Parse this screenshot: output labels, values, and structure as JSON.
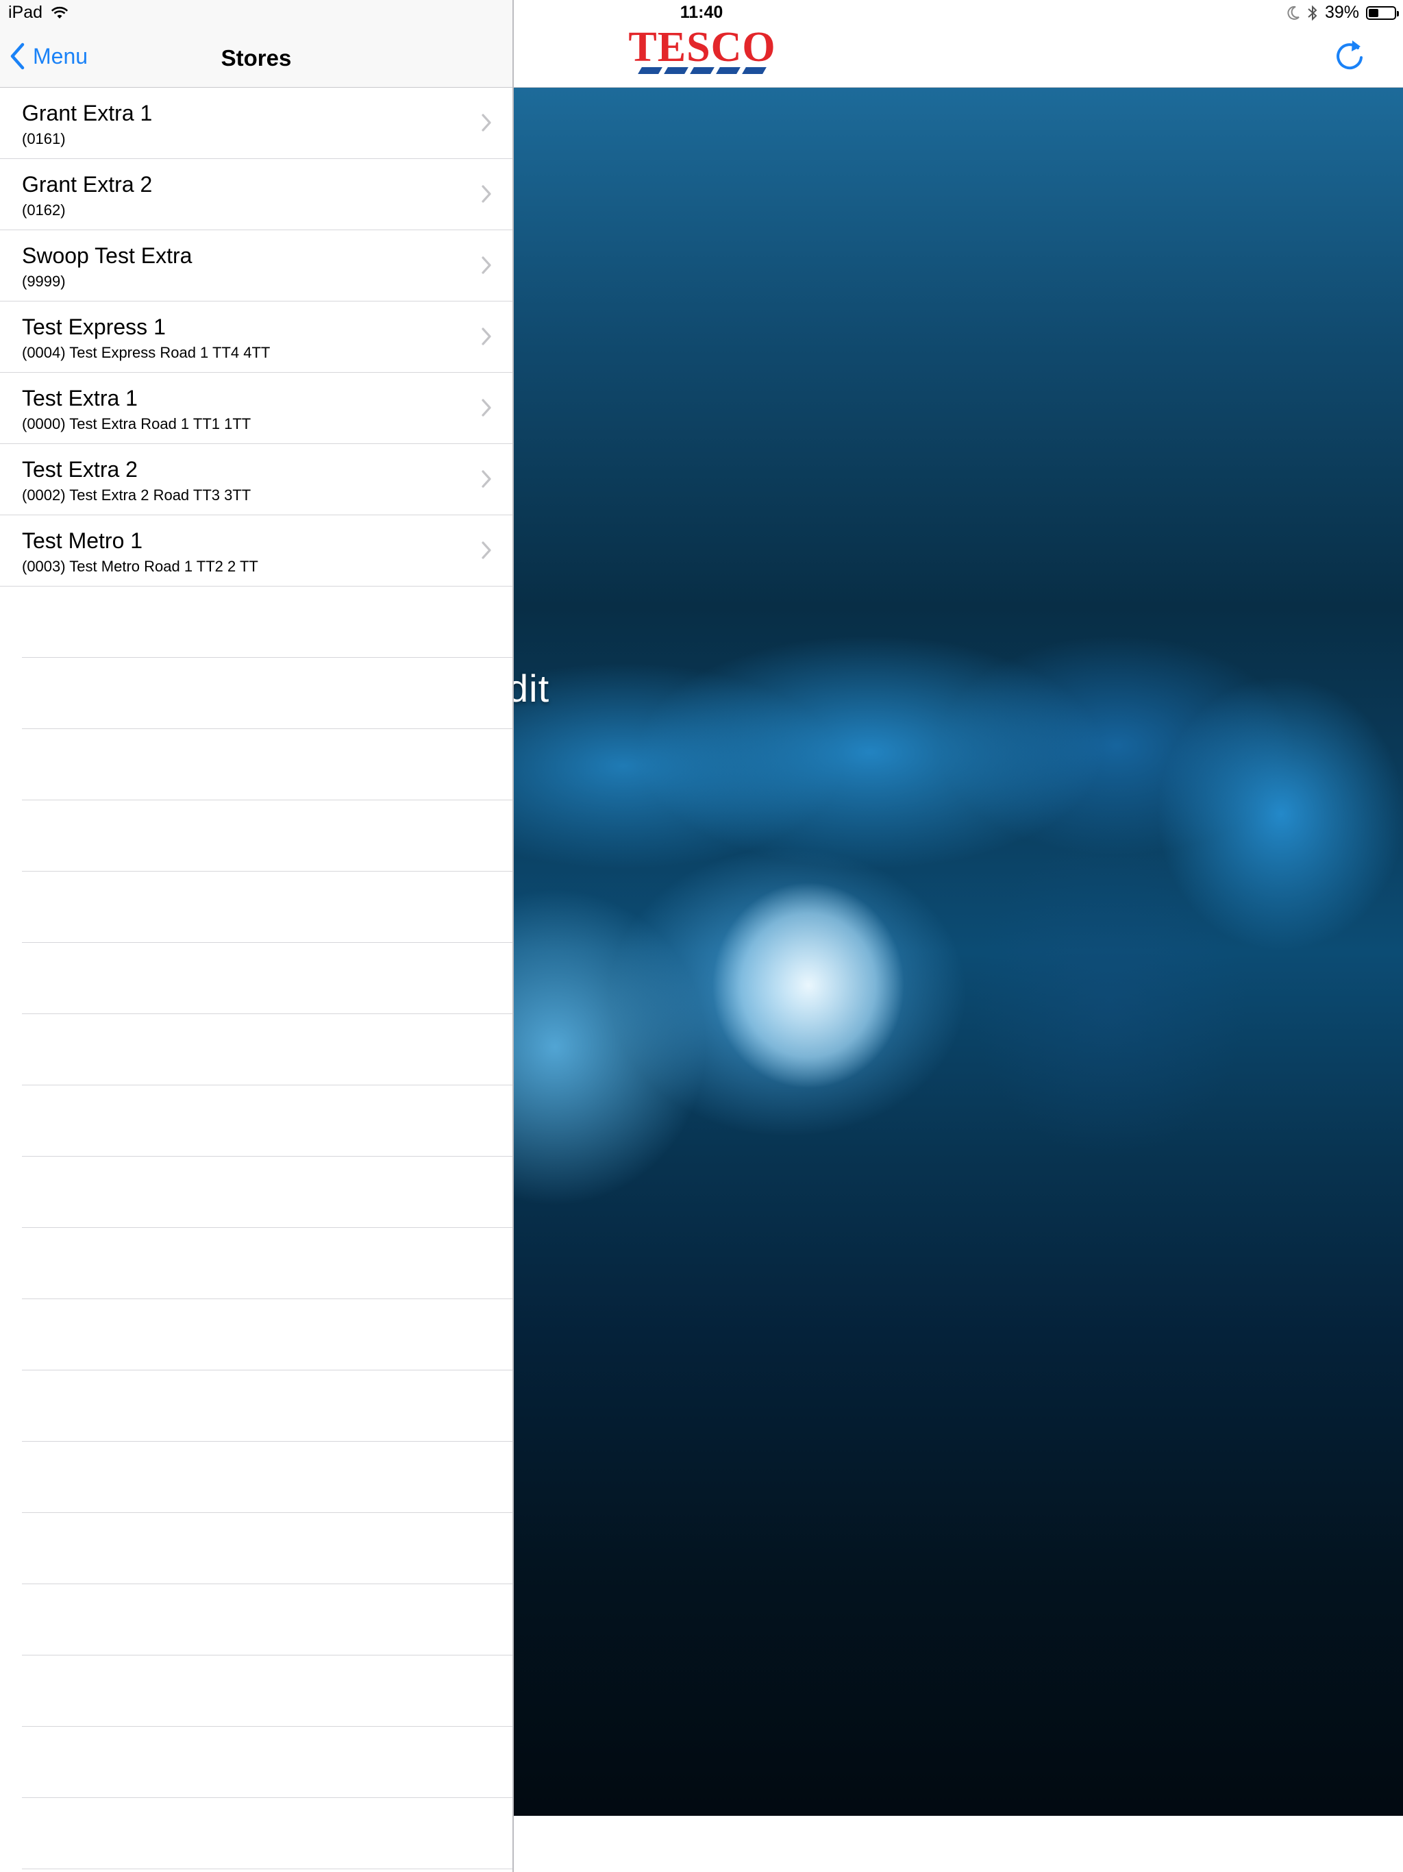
{
  "status_bar": {
    "device": "iPad",
    "time": "11:40",
    "battery_percent": "39%",
    "battery_level": 0.39,
    "icons": [
      "wifi-icon",
      "moon-icon",
      "bluetooth-icon",
      "battery-icon"
    ]
  },
  "master": {
    "back_label": "Menu",
    "title": "Stores",
    "stores": [
      {
        "name": "Grant Extra 1",
        "detail": "(0161)"
      },
      {
        "name": "Grant Extra 2",
        "detail": "(0162)"
      },
      {
        "name": "Swoop Test Extra",
        "detail": "(9999)"
      },
      {
        "name": "Test Express 1",
        "detail": "(0004) Test Express Road 1 TT4 4TT"
      },
      {
        "name": "Test Extra 1",
        "detail": "(0000) Test Extra Road 1 TT1 1TT"
      },
      {
        "name": "Test Extra 2",
        "detail": "(0002) Test Extra 2 Road TT3 3TT"
      },
      {
        "name": "Test Metro 1",
        "detail": "(0003) Test Metro Road 1 TT2 2 TT"
      }
    ]
  },
  "detail": {
    "logo_text": "TESCO",
    "hero_text": "dit",
    "refresh_icon": "refresh-icon"
  },
  "colors": {
    "accent": "#1a82f7",
    "tesco_red": "#e3262a",
    "tesco_blue": "#1c4f9c"
  }
}
